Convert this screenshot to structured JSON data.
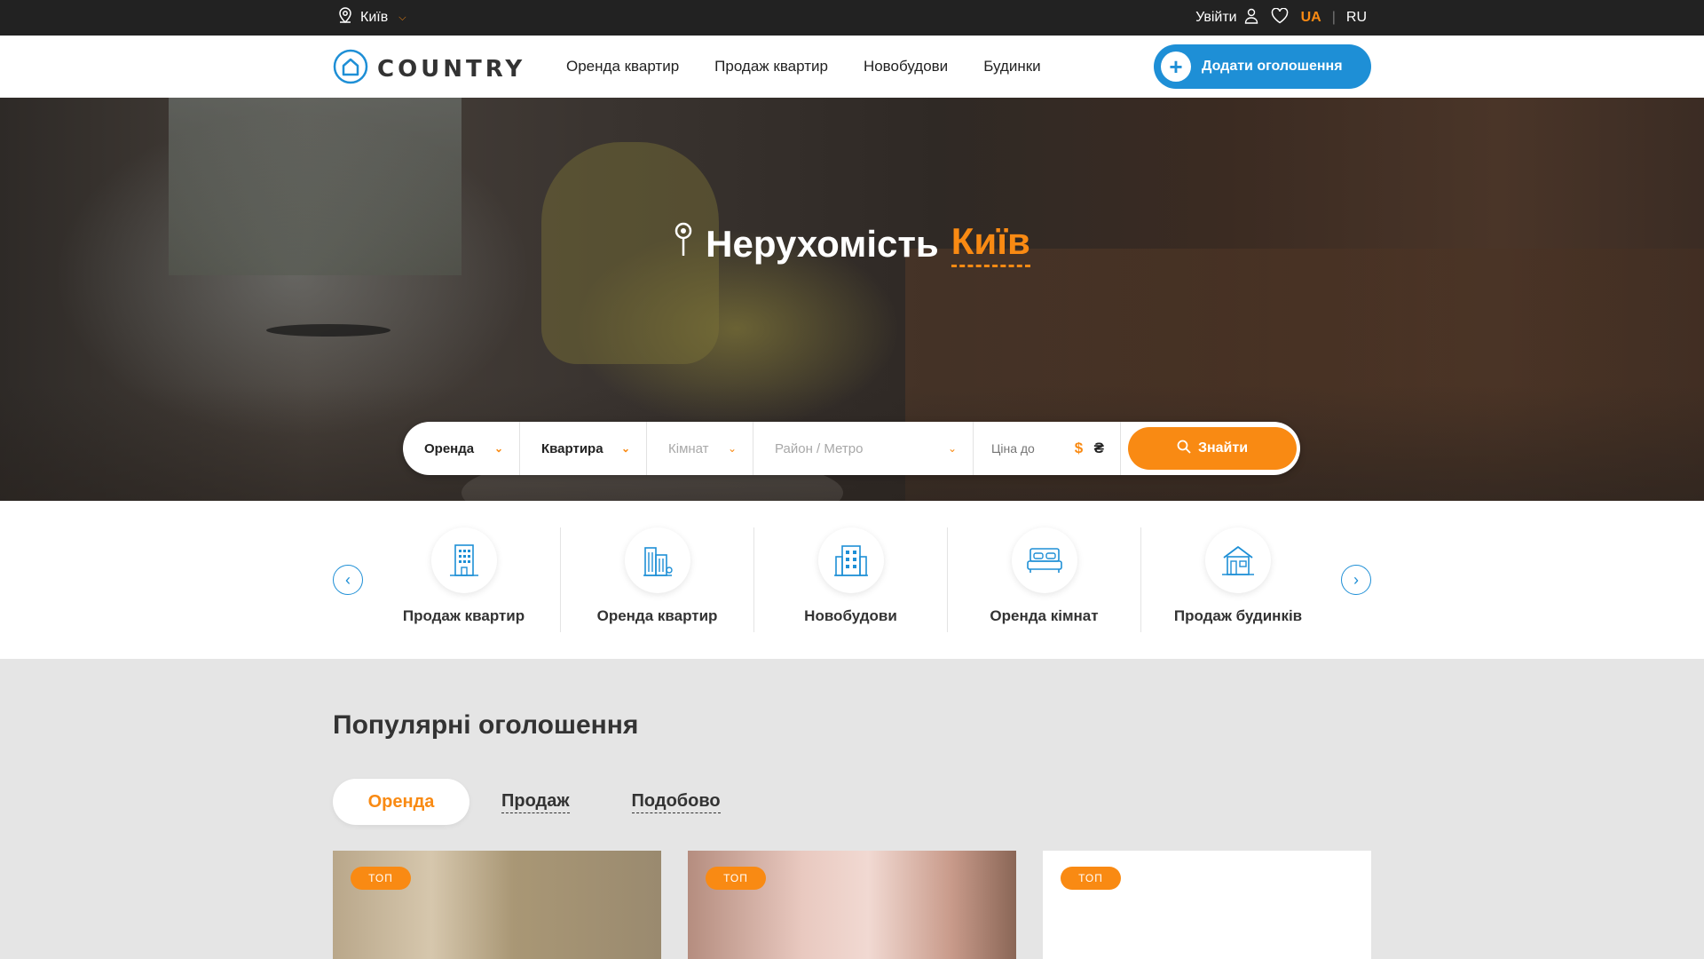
{
  "topbar": {
    "city": "Київ",
    "login_label": "Увійти",
    "lang_ua": "UA",
    "lang_sep": "|",
    "lang_ru": "RU",
    "icons": [
      "location-pin-icon",
      "chevron-down-icon",
      "user-icon",
      "heart-icon"
    ]
  },
  "header": {
    "logo_text": "COUNTRY",
    "nav": [
      "Оренда квартир",
      "Продаж квартир",
      "Новобудови",
      "Будинки"
    ],
    "add_button": "Додати оголошення"
  },
  "hero": {
    "title_prefix": "Нерухомість",
    "title_city": "Київ"
  },
  "search": {
    "deal": "Оренда",
    "type": "Квартира",
    "rooms": "Кімнат",
    "district": "Район / Метро",
    "price_placeholder": "Ціна до",
    "currency_usd": "$",
    "currency_uah": "₴",
    "button": "Знайти"
  },
  "categories": [
    {
      "label": "Продаж квартир",
      "icon": "apartment-building-icon"
    },
    {
      "label": "Оренда квартир",
      "icon": "city-buildings-icon"
    },
    {
      "label": "Новобудови",
      "icon": "new-building-icon"
    },
    {
      "label": "Оренда кімнат",
      "icon": "bed-icon"
    },
    {
      "label": "Продаж будинків",
      "icon": "house-icon"
    }
  ],
  "popular": {
    "title": "Популярні оголошення",
    "tabs": [
      "Оренда",
      "Продаж",
      "Подобово"
    ],
    "cards": [
      {
        "badge": "ТОП"
      },
      {
        "badge": "ТОП"
      },
      {
        "badge": "ТОП"
      }
    ]
  },
  "colors": {
    "accent_orange": "#f98a13",
    "accent_blue": "#1e8fd6",
    "topbar_bg": "#222222"
  }
}
